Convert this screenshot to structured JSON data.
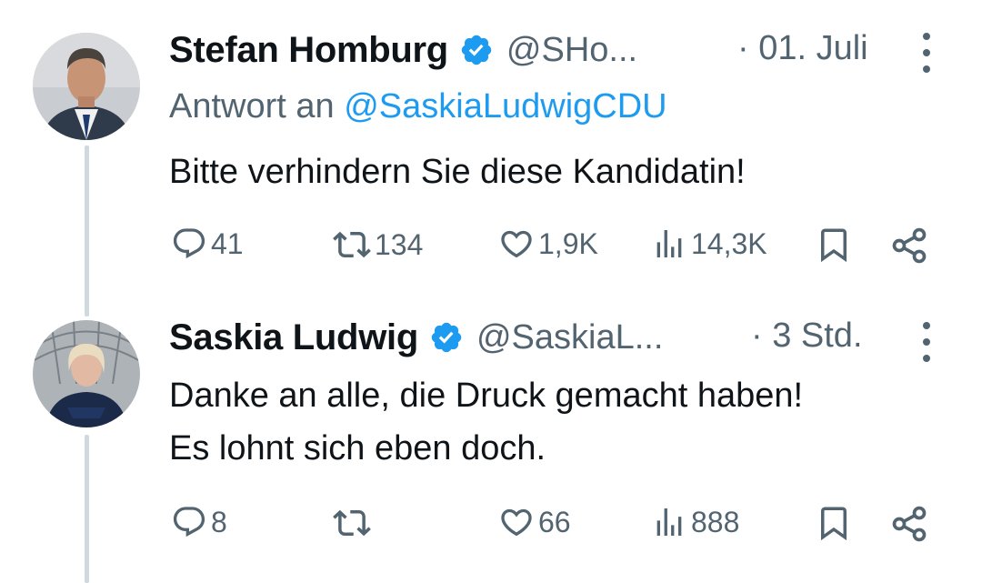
{
  "tweets": [
    {
      "name": "Stefan Homburg",
      "handle": "@SHo...",
      "time": "· 01. Juli",
      "reply_prefix": "Antwort an",
      "reply_mention": "@SaskiaLudwigCDU",
      "text": "Bitte verhindern Sie diese Kandidatin!",
      "replies": "41",
      "retweets": "134",
      "likes": "1,9K",
      "views": "14,3K"
    },
    {
      "name": "Saskia Ludwig",
      "handle": "@SaskiaL...",
      "time": "· 3 Std.",
      "text": "Danke an alle, die Druck gemacht haben!\nEs lohnt sich eben doch.",
      "replies": "8",
      "retweets": "",
      "likes": "66",
      "views": "888"
    }
  ],
  "colors": {
    "verified": "#1d9bf0",
    "mention": "#1d9bf0",
    "secondary_text": "#536471",
    "thread_line": "#cfd9de"
  },
  "icons": [
    "reply-icon",
    "retweet-icon",
    "like-icon",
    "views-icon",
    "bookmark-icon",
    "share-icon",
    "verified-badge-icon",
    "more-options-icon"
  ]
}
